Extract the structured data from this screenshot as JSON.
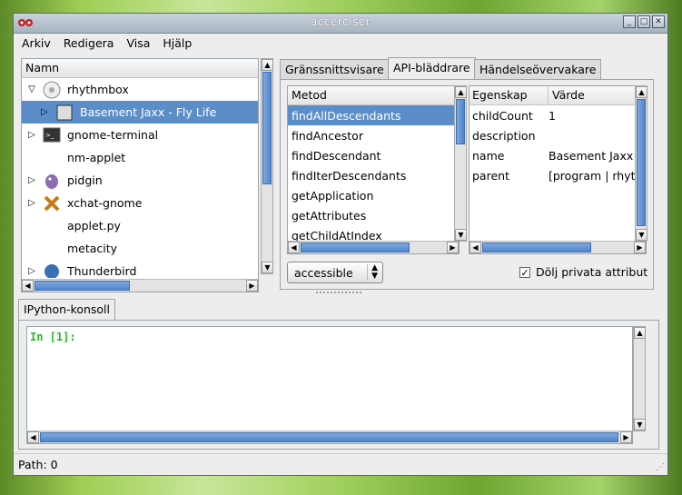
{
  "window": {
    "title": "accerciser"
  },
  "menu": [
    "Arkiv",
    "Redigera",
    "Visa",
    "Hjälp"
  ],
  "tree": {
    "header": "Namn",
    "items": [
      {
        "label": "rhythmbox",
        "icon": "rhythmbox-icon",
        "expander": "▽",
        "selected": false
      },
      {
        "label": "Basement Jaxx - Fly Life",
        "icon": "window-frame-icon",
        "expander": "▷",
        "selected": true
      },
      {
        "label": "gnome-terminal",
        "icon": "terminal-icon",
        "expander": "▷",
        "selected": false
      },
      {
        "label": "nm-applet",
        "icon": "",
        "expander": "",
        "selected": false
      },
      {
        "label": "pidgin",
        "icon": "pidgin-icon",
        "expander": "▷",
        "selected": false
      },
      {
        "label": "xchat-gnome",
        "icon": "xchat-icon",
        "expander": "▷",
        "selected": false
      },
      {
        "label": "applet.py",
        "icon": "",
        "expander": "",
        "selected": false
      },
      {
        "label": "metacity",
        "icon": "",
        "expander": "",
        "selected": false
      },
      {
        "label": "Thunderbird",
        "icon": "thunderbird-icon",
        "expander": "▷",
        "selected": false
      }
    ]
  },
  "tabs": [
    "Gränssnittsvisare",
    "API-bläddrare",
    "Händelseövervakare"
  ],
  "methods": {
    "header": "Metod",
    "items": [
      "findAllDescendants",
      "findAncestor",
      "findDescendant",
      "findIterDescendants",
      "getApplication",
      "getAttributes",
      "getChildAtIndex"
    ]
  },
  "properties": {
    "header_prop": "Egenskap",
    "header_val": "Värde",
    "rows": [
      {
        "prop": "childCount",
        "val": "1"
      },
      {
        "prop": "description",
        "val": ""
      },
      {
        "prop": "name",
        "val": "Basement Jaxx"
      },
      {
        "prop": "parent",
        "val": "[program | rhyt"
      }
    ]
  },
  "combo": {
    "value": "accessible"
  },
  "hide_private": {
    "label": "Dölj privata attribut",
    "checked": true
  },
  "console": {
    "tab": "IPython-konsoll",
    "prompt": "In [1]:"
  },
  "status": {
    "text": "Path: 0"
  }
}
